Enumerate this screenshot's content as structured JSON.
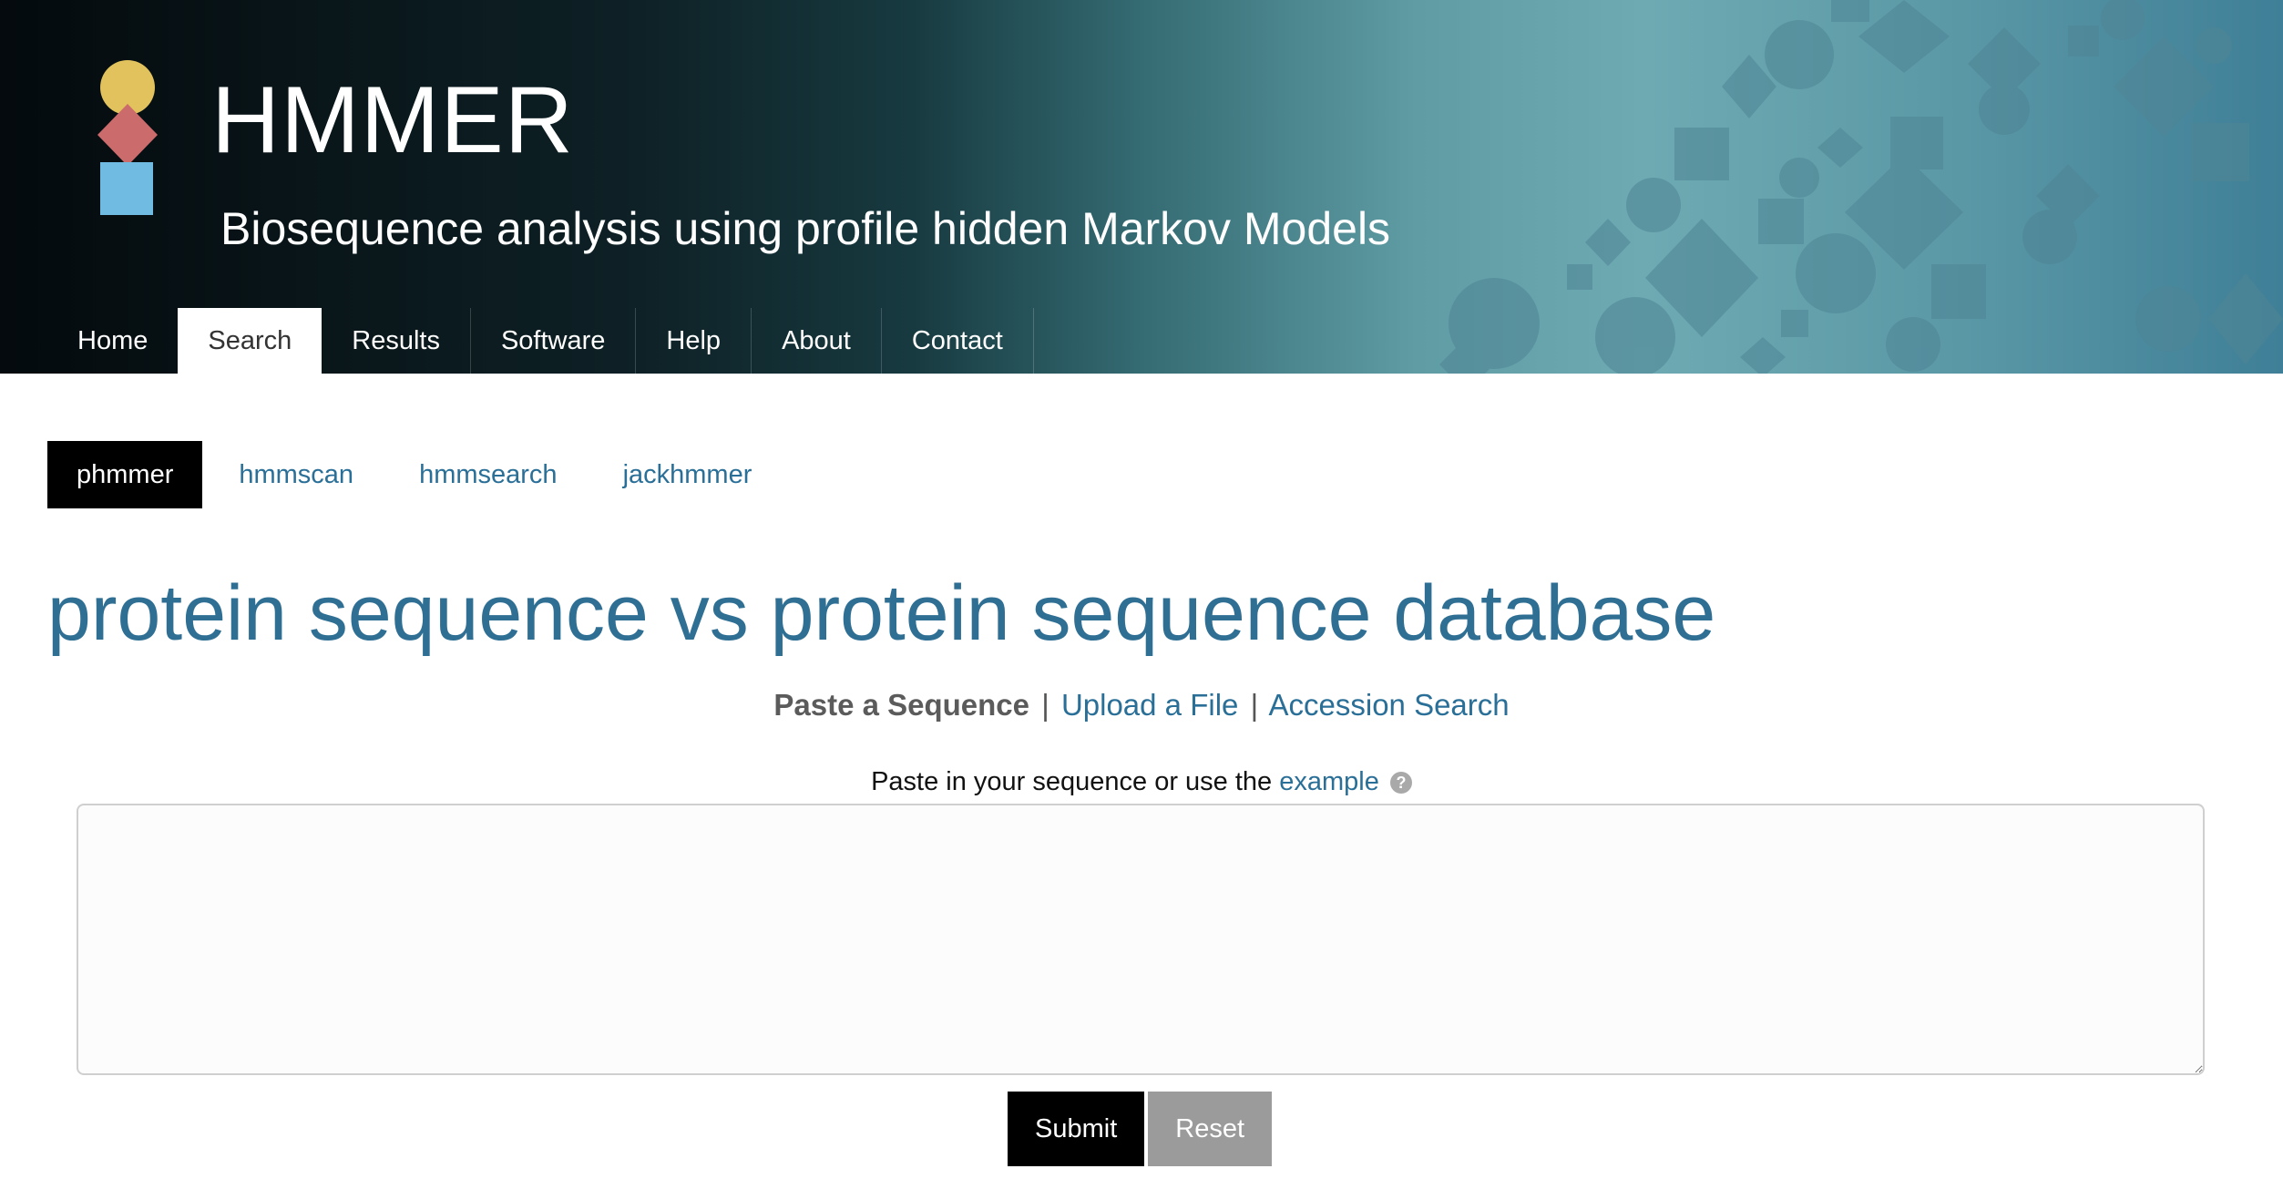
{
  "header": {
    "title": "HMMER",
    "subtitle": "Biosequence analysis using profile hidden Markov Models",
    "logo": {
      "colors": [
        "#e1c25d",
        "#cc6b6b",
        "#6fbbe2"
      ]
    },
    "nav": [
      {
        "label": "Home",
        "active": false
      },
      {
        "label": "Search",
        "active": true
      },
      {
        "label": "Results",
        "active": false
      },
      {
        "label": "Software",
        "active": false
      },
      {
        "label": "Help",
        "active": false
      },
      {
        "label": "About",
        "active": false
      },
      {
        "label": "Contact",
        "active": false
      }
    ]
  },
  "subtabs": [
    {
      "label": "phmmer",
      "active": true
    },
    {
      "label": "hmmscan",
      "active": false
    },
    {
      "label": "hmmsearch",
      "active": false
    },
    {
      "label": "jackhmmer",
      "active": false
    }
  ],
  "page_title": "protein sequence vs protein sequence database",
  "mode_switch": {
    "active": "Paste a Sequence",
    "separator": "|",
    "upload": "Upload a File",
    "accession": "Accession Search"
  },
  "instruction": {
    "text": "Paste in your sequence or use the",
    "example_link": "example",
    "help_icon": "question-circle-icon",
    "help_glyph": "?"
  },
  "sequence_input": {
    "value": "",
    "placeholder": ""
  },
  "buttons": {
    "submit": "Submit",
    "reset": "Reset"
  },
  "colors": {
    "link": "#2a6f97",
    "title": "#2f6f94",
    "active_tab": "#000000",
    "reset": "#9b9b9b"
  }
}
